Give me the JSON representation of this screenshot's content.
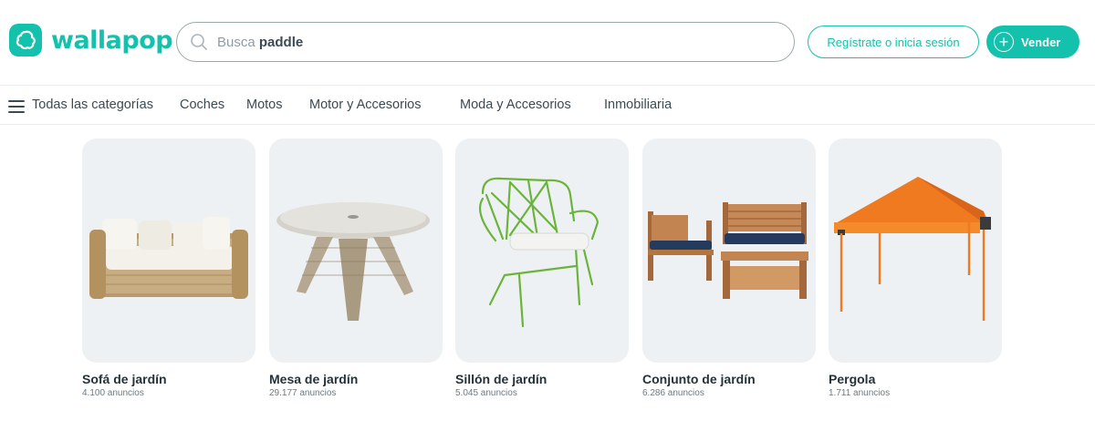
{
  "brand": {
    "name": "wallapop",
    "color": "#13c1ac",
    "logo_icon": "wallapop-logo-icon"
  },
  "search": {
    "prefix": "Busca",
    "suggestion": "paddle",
    "icon": "search-icon"
  },
  "header": {
    "register_label": "Regístrate o inicia sesión",
    "sell_label": "Vender",
    "sell_icon": "plus-circle-icon"
  },
  "nav": {
    "menu_icon": "hamburger-menu-icon",
    "all_categories": "Todas las categorías",
    "items": [
      {
        "label": "Coches"
      },
      {
        "label": "Motos"
      },
      {
        "label": "Motor y Accesorios"
      },
      {
        "label": "Moda y Accesorios"
      },
      {
        "label": "Inmobiliaria"
      }
    ]
  },
  "categories": [
    {
      "title": "Sofá de jardín",
      "count": "4.100 anuncios",
      "image": "rattan-sofa-image"
    },
    {
      "title": "Mesa de jardín",
      "count": "29.177 anuncios",
      "image": "round-rattan-table-image"
    },
    {
      "title": "Sillón de jardín",
      "count": "5.045 anuncios",
      "image": "green-wire-armchair-image"
    },
    {
      "title": "Conjunto de jardín",
      "count": "6.286 anuncios",
      "image": "wooden-garden-set-image"
    },
    {
      "title": "Pergola",
      "count": "1.711 anuncios",
      "image": "orange-canopy-tent-image"
    }
  ]
}
